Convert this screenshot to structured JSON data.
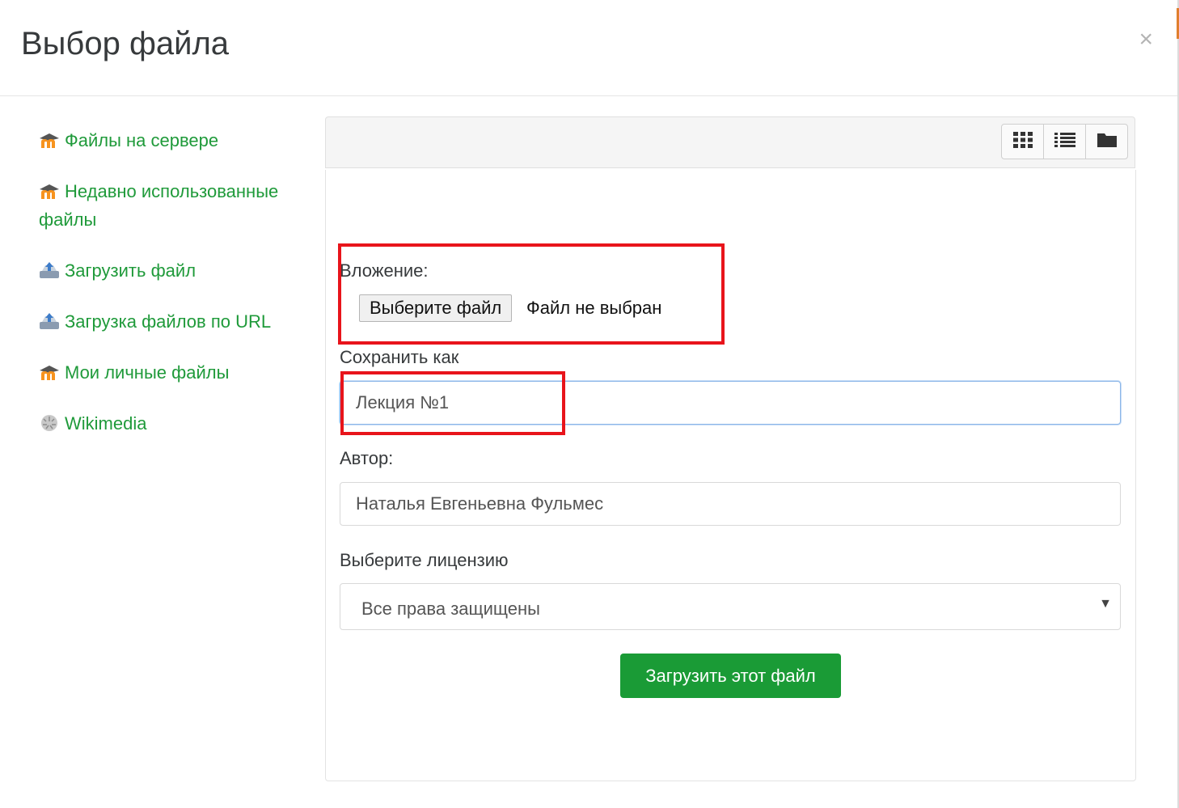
{
  "dialog": {
    "title": "Выбор файла",
    "close_glyph": "×"
  },
  "sidebar": {
    "items": [
      {
        "label": "Файлы на сервере",
        "icon": "moodle-icon"
      },
      {
        "label": "Недавно использованные файлы",
        "icon": "moodle-icon"
      },
      {
        "label": "Загрузить файл",
        "icon": "upload-icon"
      },
      {
        "label": "Загрузка файлов по URL",
        "icon": "upload-icon"
      },
      {
        "label": "Мои личные файлы",
        "icon": "moodle-icon"
      },
      {
        "label": "Wikimedia",
        "icon": "wikimedia-icon"
      }
    ],
    "link_color": "#1f9a3a"
  },
  "toolbar": {
    "views": [
      {
        "name": "grid-view",
        "icon": "grid-icon"
      },
      {
        "name": "list-view",
        "icon": "list-icon"
      },
      {
        "name": "folder-view",
        "icon": "folder-icon"
      }
    ]
  },
  "form": {
    "attachment_label": "Вложение:",
    "choose_file_button": "Выберите файл",
    "file_status": "Файл не выбран",
    "save_as_label": "Сохранить как",
    "save_as_value": "Лекция №1",
    "author_label": "Автор:",
    "author_value": "Наталья Евгеньевна Фульмес",
    "license_label": "Выберите лицензию",
    "license_value": "Все права защищены",
    "upload_button": "Загрузить этот файл",
    "upload_color": "#1a9b36",
    "highlight_color": "#e8141b"
  }
}
